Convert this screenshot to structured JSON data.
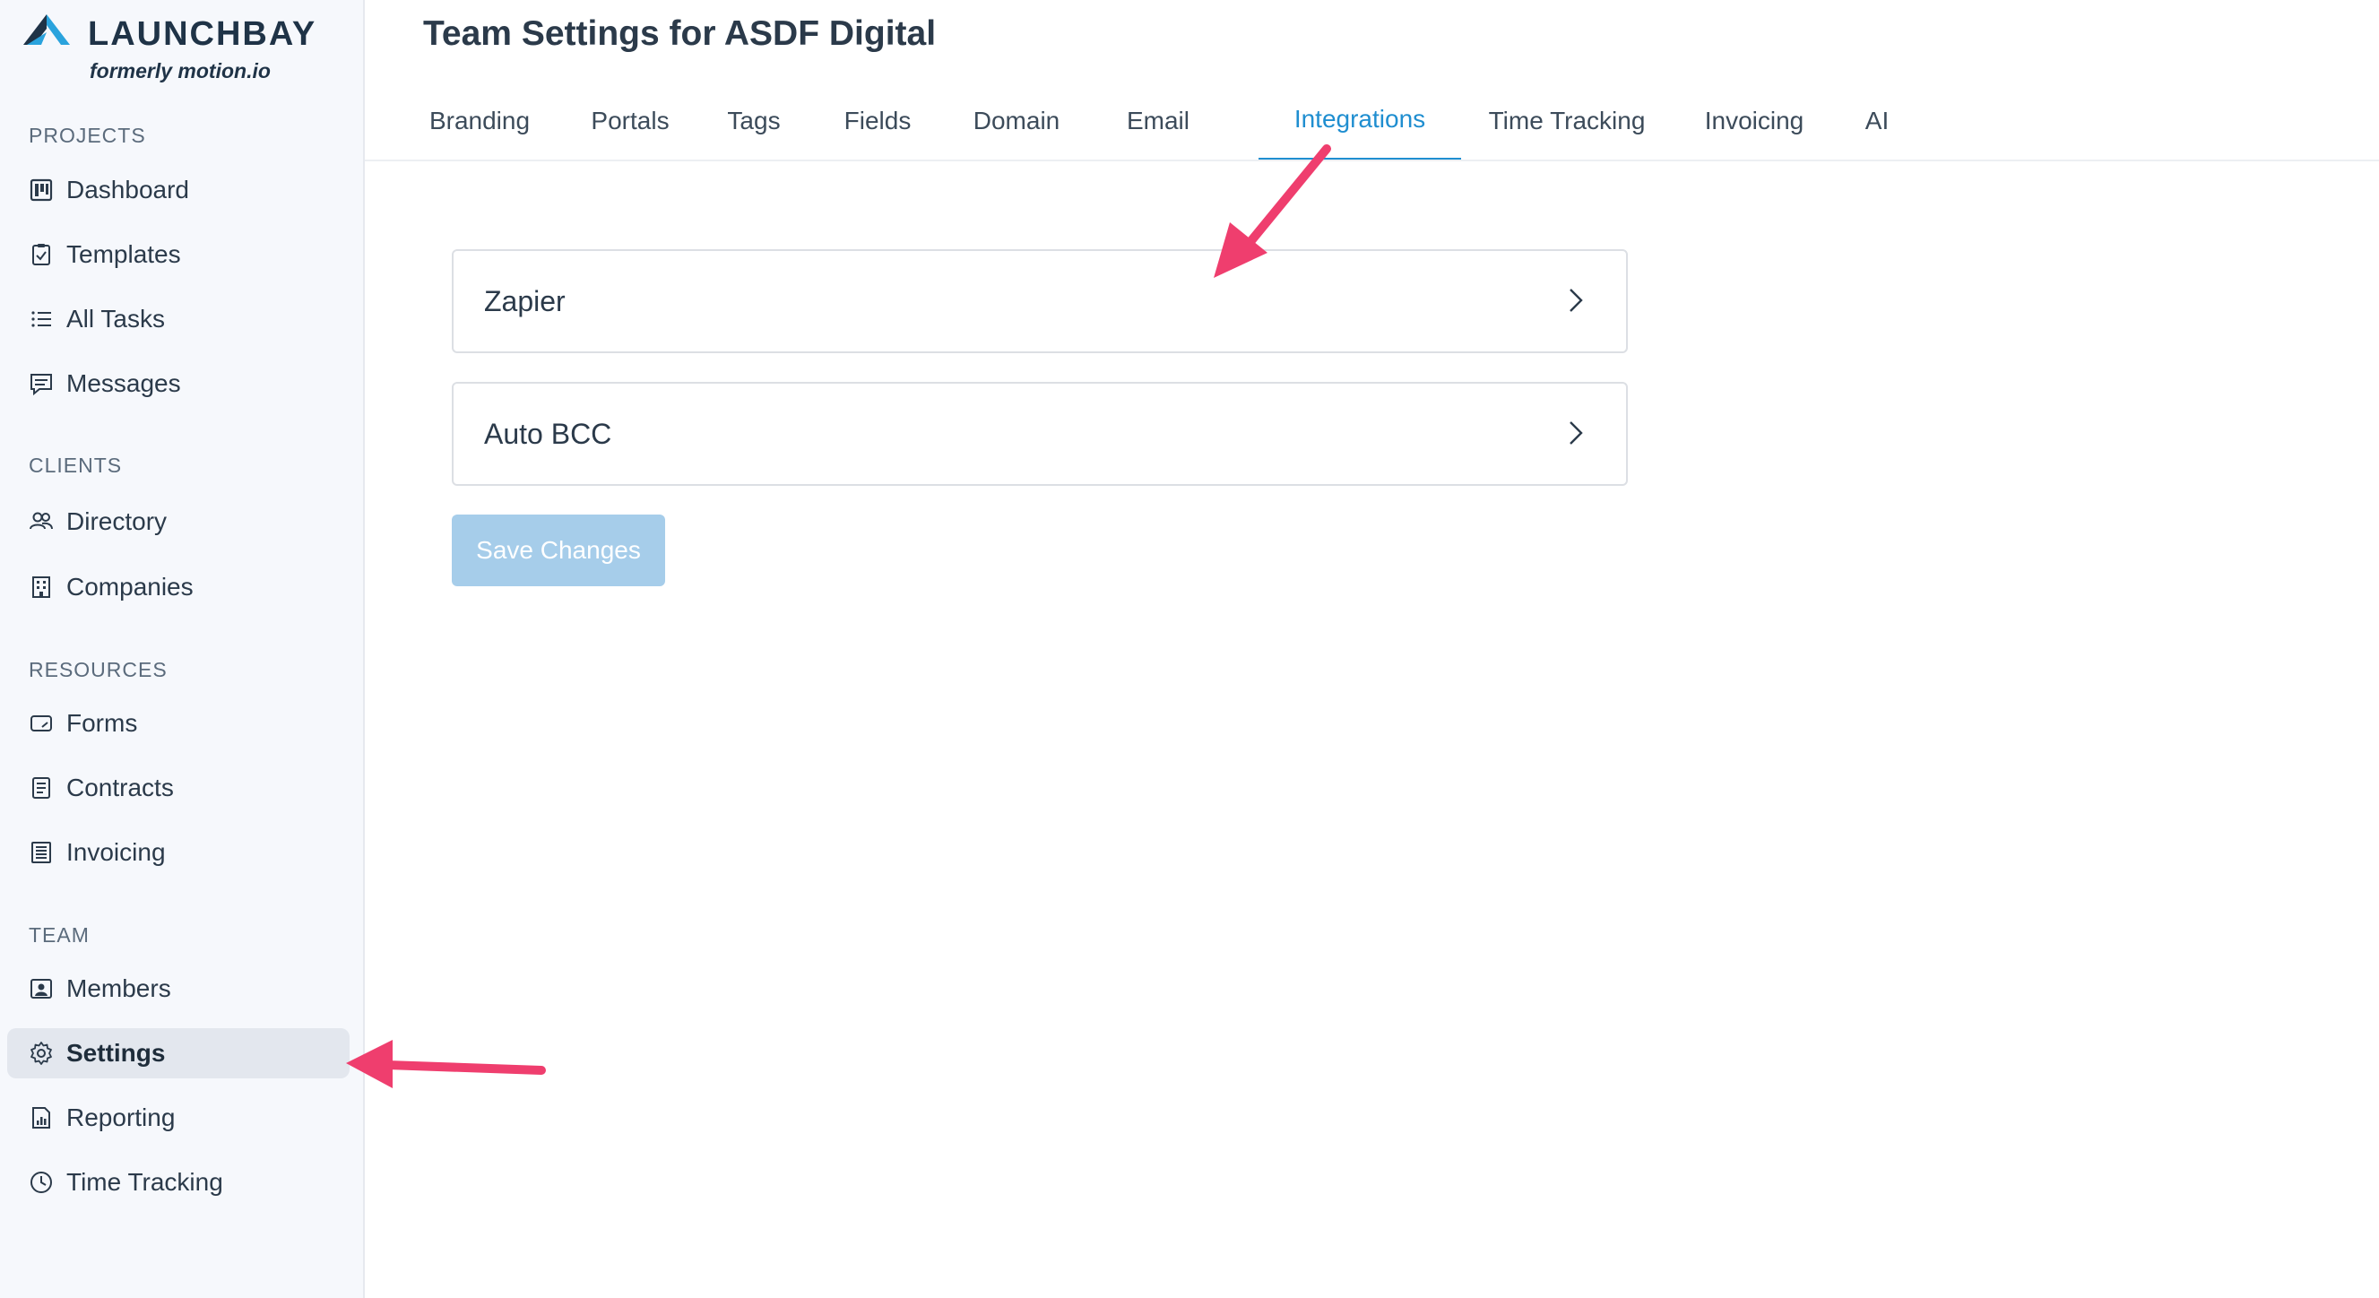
{
  "brand": {
    "name": "LAUNCHBAY",
    "subtitle": "formerly motion.io",
    "accent_color": "#2aa3dd"
  },
  "sidebar": {
    "sections": [
      {
        "title": "PROJECTS",
        "items": [
          {
            "label": "Dashboard",
            "icon": "dashboard-icon"
          },
          {
            "label": "Templates",
            "icon": "clipboard-check-icon"
          },
          {
            "label": "All Tasks",
            "icon": "list-icon"
          },
          {
            "label": "Messages",
            "icon": "message-icon"
          }
        ]
      },
      {
        "title": "CLIENTS",
        "items": [
          {
            "label": "Directory",
            "icon": "users-icon"
          },
          {
            "label": "Companies",
            "icon": "building-icon"
          }
        ]
      },
      {
        "title": "RESOURCES",
        "items": [
          {
            "label": "Forms",
            "icon": "form-icon"
          },
          {
            "label": "Contracts",
            "icon": "document-icon"
          },
          {
            "label": "Invoicing",
            "icon": "invoice-icon"
          }
        ]
      },
      {
        "title": "TEAM",
        "items": [
          {
            "label": "Members",
            "icon": "member-card-icon"
          },
          {
            "label": "Settings",
            "icon": "gear-icon",
            "active": true
          },
          {
            "label": "Reporting",
            "icon": "report-icon"
          },
          {
            "label": "Time Tracking",
            "icon": "clock-icon"
          }
        ]
      }
    ]
  },
  "main": {
    "title": "Team Settings for ASDF Digital",
    "tabs": [
      {
        "label": "Branding"
      },
      {
        "label": "Portals"
      },
      {
        "label": "Tags"
      },
      {
        "label": "Fields"
      },
      {
        "label": "Domain"
      },
      {
        "label": "Email"
      },
      {
        "label": "Integrations",
        "active": true
      },
      {
        "label": "Time Tracking"
      },
      {
        "label": "Invoicing"
      },
      {
        "label": "AI"
      }
    ],
    "integrations": [
      {
        "label": "Zapier"
      },
      {
        "label": "Auto BCC"
      }
    ],
    "save_label": "Save Changes",
    "save_enabled": false,
    "active_tab_color": "#1f8ed0",
    "annotation_arrow_color": "#ef3e6e"
  }
}
